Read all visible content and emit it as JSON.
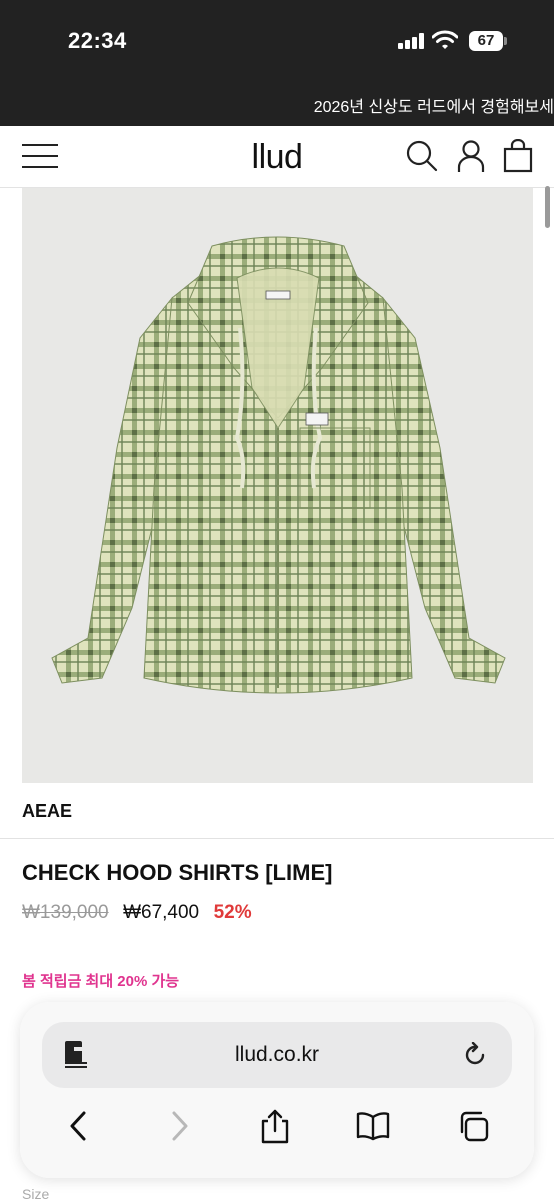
{
  "status_bar": {
    "time": "22:34",
    "battery": "67"
  },
  "banner": {
    "text": "2026년 신상도 러드에서 경험해보세"
  },
  "header": {
    "logo": "llud"
  },
  "product": {
    "brand": "AEAE",
    "name": "CHECK HOOD SHIRTS [LIME]",
    "original_price": "₩139,000",
    "sale_price": "₩67,400",
    "discount": "52%",
    "points_text": "봄 적립금 최대 20% 가능",
    "size_label": "Size"
  },
  "browser": {
    "url": "llud.co.kr"
  },
  "colors": {
    "discount": "#e03a3a",
    "points": "#e0348f",
    "banner_bg": "#222222"
  }
}
